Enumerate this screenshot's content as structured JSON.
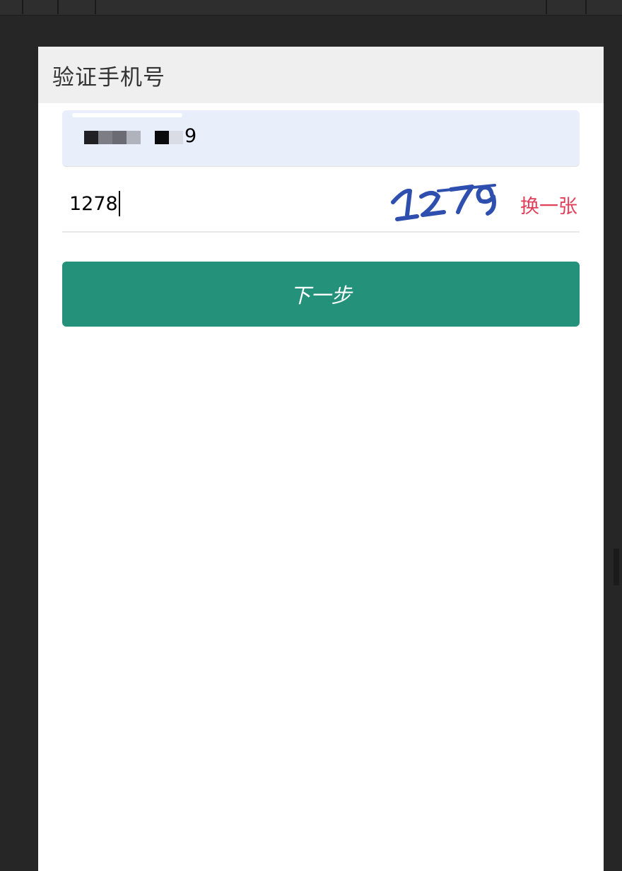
{
  "dialog": {
    "title": "验证手机号"
  },
  "phone": {
    "visible_tail": "9"
  },
  "captcha": {
    "input_value": "1278",
    "image_text": "1279",
    "refresh_label": "换一张"
  },
  "actions": {
    "next_label": "下一步"
  },
  "colors": {
    "primary": "#24917a",
    "link": "#e0405a",
    "captcha_ink": "#2f4fae",
    "phone_field_bg": "#e8effb",
    "header_bg": "#efefef",
    "backdrop": "#262626"
  }
}
